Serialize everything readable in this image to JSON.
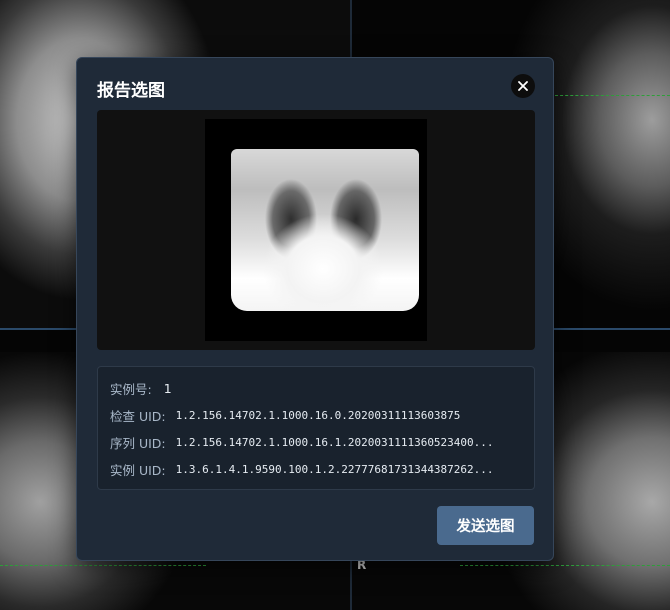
{
  "background": {
    "orientation_marker": "R"
  },
  "dialog": {
    "title": "报告选图",
    "close_icon": "close-icon",
    "info": {
      "instance_number_label": "实例号:",
      "instance_number_value": "1",
      "study_uid_label": "检查 UID:",
      "study_uid_value": "1.2.156.14702.1.1000.16.0.20200311113603875",
      "series_uid_label": "序列 UID:",
      "series_uid_value": "1.2.156.14702.1.1000.16.1.2020031111360523400...",
      "sop_uid_label": "实例 UID:",
      "sop_uid_value": "1.3.6.1.4.1.9590.100.1.2.22777681731344387262..."
    },
    "send_button_label": "发送选图"
  },
  "colors": {
    "dialog_bg": "#1f2a38",
    "button_bg": "#4a6a8e",
    "dashed_line": "#2e9e3a"
  }
}
